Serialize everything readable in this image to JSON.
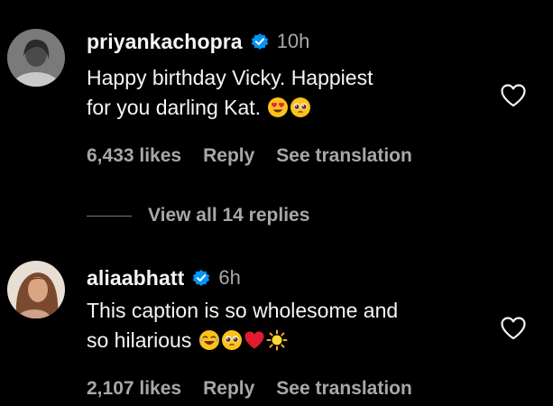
{
  "comments": [
    {
      "username": "priyankachopra",
      "verified": true,
      "time": "10h",
      "text_line1": "Happy birthday Vicky. Happiest",
      "text_line2": "for you darling Kat.",
      "emojis": [
        "heart-eyes-emoji",
        "pleading-face-emoji"
      ],
      "likes": "6,433 likes",
      "reply_label": "Reply",
      "translation_label": "See translation",
      "view_replies": "View all 14 replies"
    },
    {
      "username": "aliaabhatt",
      "verified": true,
      "time": "6h",
      "text_line1": "This caption is so wholesome and",
      "text_line2": "so hilarious",
      "emojis": [
        "tears-of-joy-emoji",
        "pleading-face-emoji",
        "red-heart-emoji",
        "sun-emoji"
      ],
      "likes": "2,107 likes",
      "reply_label": "Reply",
      "translation_label": "See translation"
    }
  ],
  "colors": {
    "background": "#000000",
    "primary_text": "#f5f5f5",
    "secondary_text": "#a8a8a8",
    "verified_badge": "#0095f6"
  }
}
